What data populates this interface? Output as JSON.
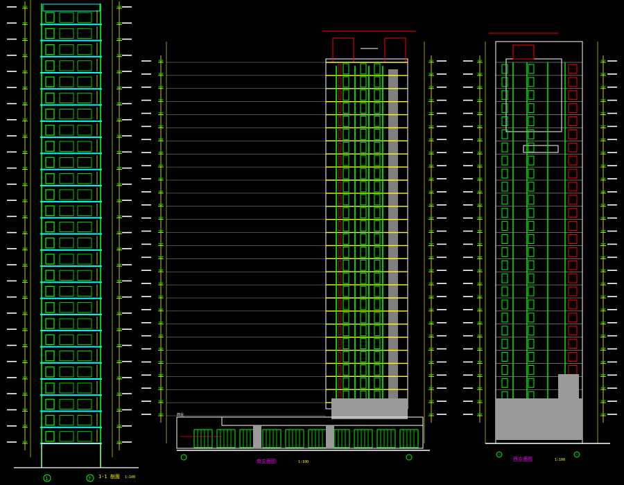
{
  "drawing": {
    "section_title": "1-1 剖面",
    "section_scale": "1:100",
    "elev_south_title": "南立面图",
    "elev_south_scale": "1:100",
    "elev_west_title": "西立面图",
    "elev_west_scale": "1:100",
    "axis_left": "1",
    "axis_right": "7",
    "floor_count": 27,
    "podium_label": "商业",
    "colors": {
      "background": "#000000",
      "green": "#00ff00",
      "yellow": "#ffff00",
      "red": "#ff0000",
      "cyan": "#00ffff",
      "white": "#ffffff",
      "magenta": "#ff00ff",
      "gray": "#808080"
    }
  }
}
